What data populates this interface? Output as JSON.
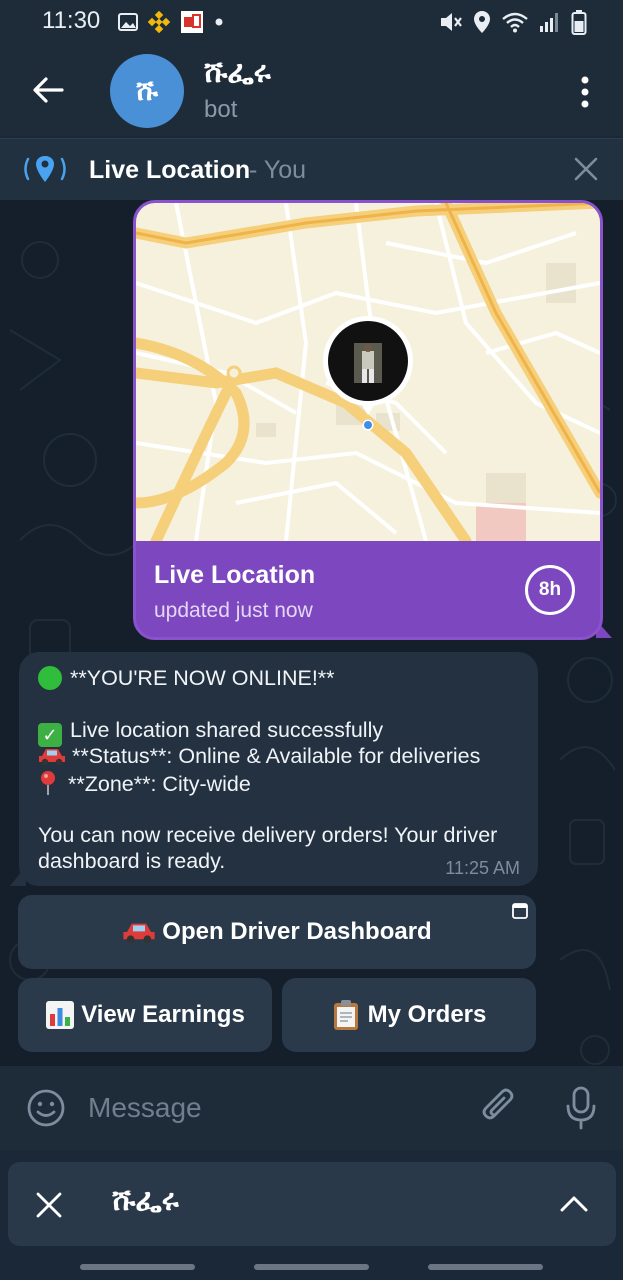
{
  "status_bar": {
    "time": "11:30",
    "icons": [
      "gallery-icon",
      "binance-icon",
      "app-notification-icon",
      "dot-icon",
      "muted-icon",
      "location-icon",
      "wifi-icon",
      "signal-icon",
      "battery-icon"
    ]
  },
  "header": {
    "title": "ሹፌሩ",
    "subtitle": "bot",
    "avatar_letter": "ሹ",
    "avatar_color": "#4a90d6"
  },
  "live_bar": {
    "label": "Live Location",
    "suffix": " - You"
  },
  "map_message": {
    "title": "Live Location",
    "subtitle": "updated just now",
    "timer": "8h",
    "accent": "#7d47c0"
  },
  "bot_message": {
    "line1": "**YOU'RE NOW ONLINE!**",
    "line2": "Live location shared successfully",
    "line3": "**Status**: Online & Available for deliveries",
    "line4": "**Zone**: City-wide",
    "line5": "You can now receive delivery orders! Your driver",
    "line6": "dashboard is ready.",
    "time": "11:25 AM"
  },
  "keyboard": {
    "dashboard": "Open Driver Dashboard",
    "earnings": "View Earnings",
    "orders": "My Orders"
  },
  "input": {
    "placeholder": "Message"
  },
  "bottom_panel": {
    "title": "ሹፌሩ"
  }
}
